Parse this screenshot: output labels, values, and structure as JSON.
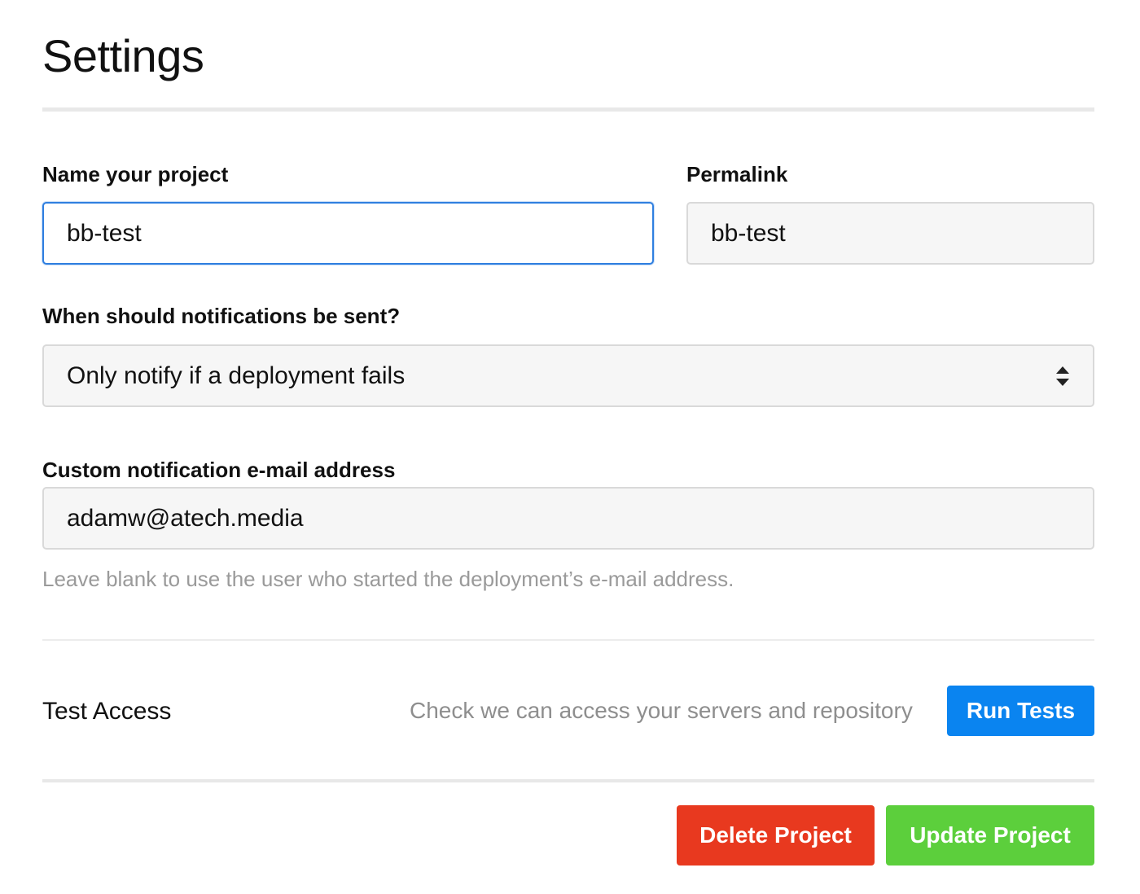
{
  "page": {
    "title": "Settings"
  },
  "form": {
    "name_label": "Name your project",
    "name_value": "bb-test",
    "permalink_label": "Permalink",
    "permalink_value": "bb-test",
    "notifications_label": "When should notifications be sent?",
    "notifications_selected": "Only notify if a deployment fails",
    "email_label": "Custom notification e-mail address",
    "email_value": "adamw@atech.media",
    "email_help": "Leave blank to use the user who started the deployment’s e-mail address."
  },
  "test_access": {
    "title": "Test Access",
    "description": "Check we can access your servers and repository",
    "button_label": "Run Tests"
  },
  "actions": {
    "delete_label": "Delete Project",
    "update_label": "Update Project"
  },
  "colors": {
    "primary": "#0a84f0",
    "danger": "#e8391f",
    "success": "#5ccf3c",
    "focus_border": "#2f7fe0"
  },
  "icons": {
    "select_arrows": "up-down-chevron-icon"
  }
}
